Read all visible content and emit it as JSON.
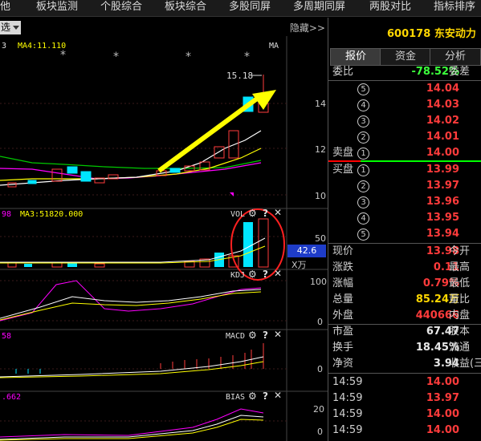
{
  "menu": [
    "他",
    "板块监测",
    "个股综合",
    "板块综合",
    "多股同屏",
    "多周期同屏",
    "两股对比",
    "指标排序"
  ],
  "chart_header": {
    "dropdown": "选",
    "ma_prefix": "3",
    "ma4": "MA4:11.110",
    "ma_tag": "MA",
    "hide_label": "隐藏>>"
  },
  "main_chart": {
    "high_label": "15.18",
    "y_ticks": [
      "14",
      "12",
      "10"
    ]
  },
  "vol_panel": {
    "prefix": "98",
    "ma3": "MA3:51820.000",
    "name": "VOL",
    "y_tick": "50",
    "value_box": "42.6",
    "unit": "X万"
  },
  "kd_panel": {
    "name": "KDJ",
    "ticks": [
      "100",
      "0"
    ]
  },
  "macd_panel": {
    "prefix": "58",
    "name": "MACD",
    "ticks": [
      "0"
    ]
  },
  "bias_panel": {
    "prefix": ".662",
    "name": "BIAS",
    "ticks": [
      "20",
      "0"
    ]
  },
  "stock": {
    "code": "600178",
    "name": "东安动力"
  },
  "tabs": [
    "报价",
    "资金",
    "分析"
  ],
  "ratio": {
    "label": "委比",
    "value": "-78.52%",
    "label2": "委差"
  },
  "sell_orders": [
    {
      "n": "5",
      "price": "14.04"
    },
    {
      "n": "4",
      "price": "14.03"
    },
    {
      "n": "3",
      "price": "14.02"
    },
    {
      "n": "2",
      "price": "14.01"
    },
    {
      "n": "1",
      "price": "14.00",
      "label": "卖盘"
    }
  ],
  "buy_orders": [
    {
      "n": "1",
      "price": "13.99",
      "label": "买盘"
    },
    {
      "n": "2",
      "price": "13.97"
    },
    {
      "n": "3",
      "price": "13.96"
    },
    {
      "n": "4",
      "price": "13.95"
    },
    {
      "n": "5",
      "price": "13.94"
    }
  ],
  "quote": [
    {
      "label": "现价",
      "value": "13.98",
      "label2": "今开"
    },
    {
      "label": "涨跌",
      "value": "0.11",
      "label2": "最高"
    },
    {
      "label": "涨幅",
      "value": "0.79%",
      "label2": "最低"
    },
    {
      "label": "总量",
      "value": "85.24万",
      "label2": "量比"
    },
    {
      "label": "外盘",
      "value": "440666",
      "label2": "内盘"
    },
    {
      "label": "市盈",
      "value": "67.47",
      "label2": "股本"
    },
    {
      "label": "换手",
      "value": "18.45%",
      "label2": "流通"
    },
    {
      "label": "净资",
      "value": "3.94",
      "label2": "收益(三"
    }
  ],
  "ticks": [
    {
      "time": "14:59",
      "price": "14.00"
    },
    {
      "time": "14:59",
      "price": "13.97"
    },
    {
      "time": "14:59",
      "price": "14.00"
    },
    {
      "time": "14:59",
      "price": "14.00"
    }
  ],
  "colors": {
    "up": "#ff3b3b",
    "down": "#00e5ff",
    "ma_white": "#ffffff",
    "ma_yellow": "#ffff00",
    "ma_magenta": "#ff00ff",
    "ma_green": "#00c800",
    "arrow": "#ffff00",
    "circle": "#ff2020",
    "accent_line": "#00ff00",
    "sell_line": "#ff0000"
  }
}
